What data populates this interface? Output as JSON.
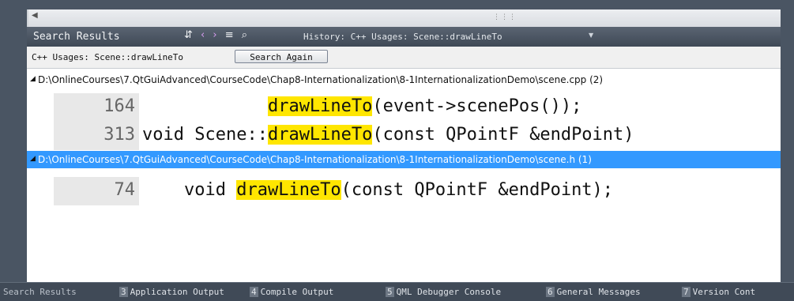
{
  "toolbar": {
    "title": "Search Results",
    "history": "History: C++ Usages: Scene::drawLineTo"
  },
  "search": {
    "label": "C++ Usages: Scene::drawLineTo",
    "button": "Search Again"
  },
  "results": [
    {
      "path": "D:\\OnlineCourses\\7.QtGuiAdvanced\\CourseCode\\Chap8-Internationalization\\8-1InternationalizationDemo\\scene.cpp (2)",
      "selected": false,
      "lines": [
        {
          "num": "164",
          "pre": "            ",
          "match": "drawLineTo",
          "post": "(event->scenePos());"
        },
        {
          "num": "313",
          "pre": "void Scene::",
          "match": "drawLineTo",
          "post": "(const QPointF &endPoint)"
        }
      ]
    },
    {
      "path": "D:\\OnlineCourses\\7.QtGuiAdvanced\\CourseCode\\Chap8-Internationalization\\8-1InternationalizationDemo\\scene.h (1)",
      "selected": true,
      "lines": [
        {
          "num": "74",
          "pre": "    void ",
          "match": "drawLineTo",
          "post": "(const QPointF &endPoint);"
        }
      ]
    }
  ],
  "tabs": [
    {
      "num": "",
      "label": "Search Results",
      "active": true
    },
    {
      "num": "3",
      "label": "Application Output"
    },
    {
      "num": "4",
      "label": "Compile Output"
    },
    {
      "num": "5",
      "label": "QML Debugger Console"
    },
    {
      "num": "6",
      "label": "General Messages"
    },
    {
      "num": "7",
      "label": "Version Cont"
    }
  ],
  "colors": {
    "highlight": "#ffe600",
    "selection": "#3399ff",
    "panel": "#4a5563"
  }
}
